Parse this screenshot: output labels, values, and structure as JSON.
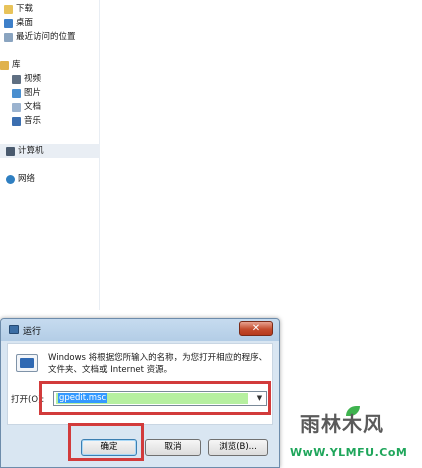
{
  "nav": {
    "favorites": [
      {
        "label": "下载",
        "icon": "download-folder-icon"
      },
      {
        "label": "桌面",
        "icon": "desktop-icon"
      },
      {
        "label": "最近访问的位置",
        "icon": "recent-places-icon"
      }
    ],
    "library": {
      "label": "库",
      "icon": "library-icon"
    },
    "library_items": [
      {
        "label": "视频",
        "icon": "video-icon"
      },
      {
        "label": "图片",
        "icon": "pictures-icon"
      },
      {
        "label": "文档",
        "icon": "documents-icon"
      },
      {
        "label": "音乐",
        "icon": "music-icon"
      }
    ],
    "computer": {
      "label": "计算机",
      "icon": "computer-icon"
    },
    "network": {
      "label": "网络",
      "icon": "network-icon"
    }
  },
  "dialog": {
    "title": "运行",
    "close_label": "✕",
    "description": "Windows 将根据您所输入的名称，为您打开相应的程序、文件夹、文档或 Internet 资源。",
    "open_label": "打开(O):",
    "command_value": "gpedit.msc",
    "ok_label": "确定",
    "cancel_label": "取消",
    "browse_label": "浏览(B)..."
  },
  "watermark": {
    "brand": "雨林木风",
    "url": "WwW.YLMFU.CoM"
  },
  "colors": {
    "highlight": "#d23b3b",
    "selection": "#3399ff",
    "field_bg": "#b6f0a0",
    "dialog_bg": "#d9e6f2"
  }
}
